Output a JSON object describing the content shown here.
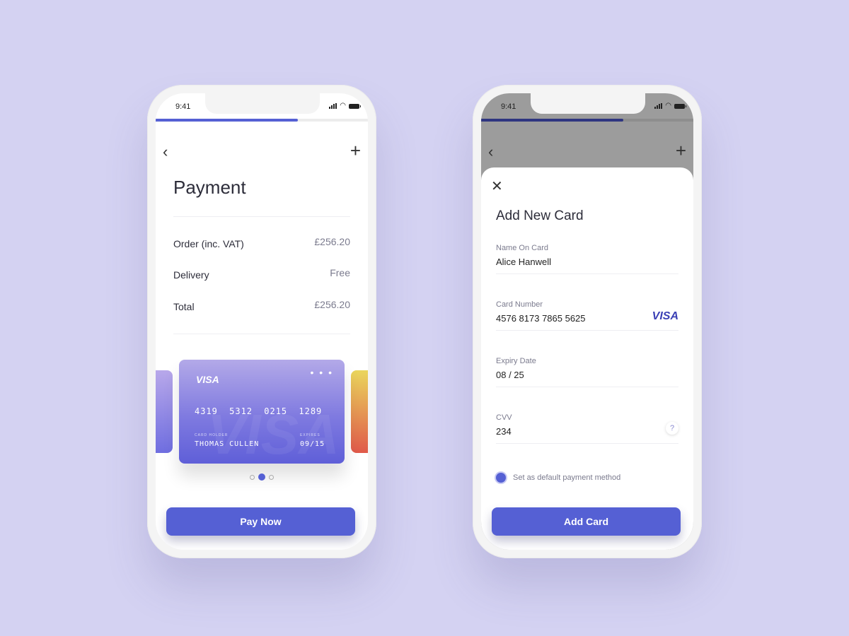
{
  "status": {
    "time": "9:41"
  },
  "progress": {
    "value": 0.67
  },
  "payment_screen": {
    "title": "Payment",
    "rows": [
      {
        "label": "Order (inc. VAT)",
        "value": "£256.20"
      },
      {
        "label": "Delivery",
        "value": "Free"
      },
      {
        "label": "Total",
        "value": "£256.20"
      }
    ],
    "card": {
      "brand": "VISA",
      "menu": "• • •",
      "number": "4319 5312 0215 1289",
      "holder_label": "CARD HOLDER",
      "holder": "THOMAS CULLEN",
      "expires_label": "EXPIRES",
      "expires": "09/15"
    },
    "carousel": {
      "count": 3,
      "active": 2
    },
    "pay_button": "Pay Now"
  },
  "add_card_screen": {
    "title": "Add New Card",
    "fields": {
      "name": {
        "label": "Name On Card",
        "value": "Alice Hanwell"
      },
      "number": {
        "label": "Card Number",
        "value": "4576 8173 7865 5625",
        "brand": "VISA"
      },
      "expiry": {
        "label": "Expiry Date",
        "value": "08 / 25"
      },
      "cvv": {
        "label": "CVV",
        "value": "234",
        "help": "?"
      }
    },
    "default_label": "Set as default payment method",
    "add_button": "Add Card"
  },
  "colors": {
    "accent": "#5560d4",
    "background": "#d4d2f2"
  }
}
